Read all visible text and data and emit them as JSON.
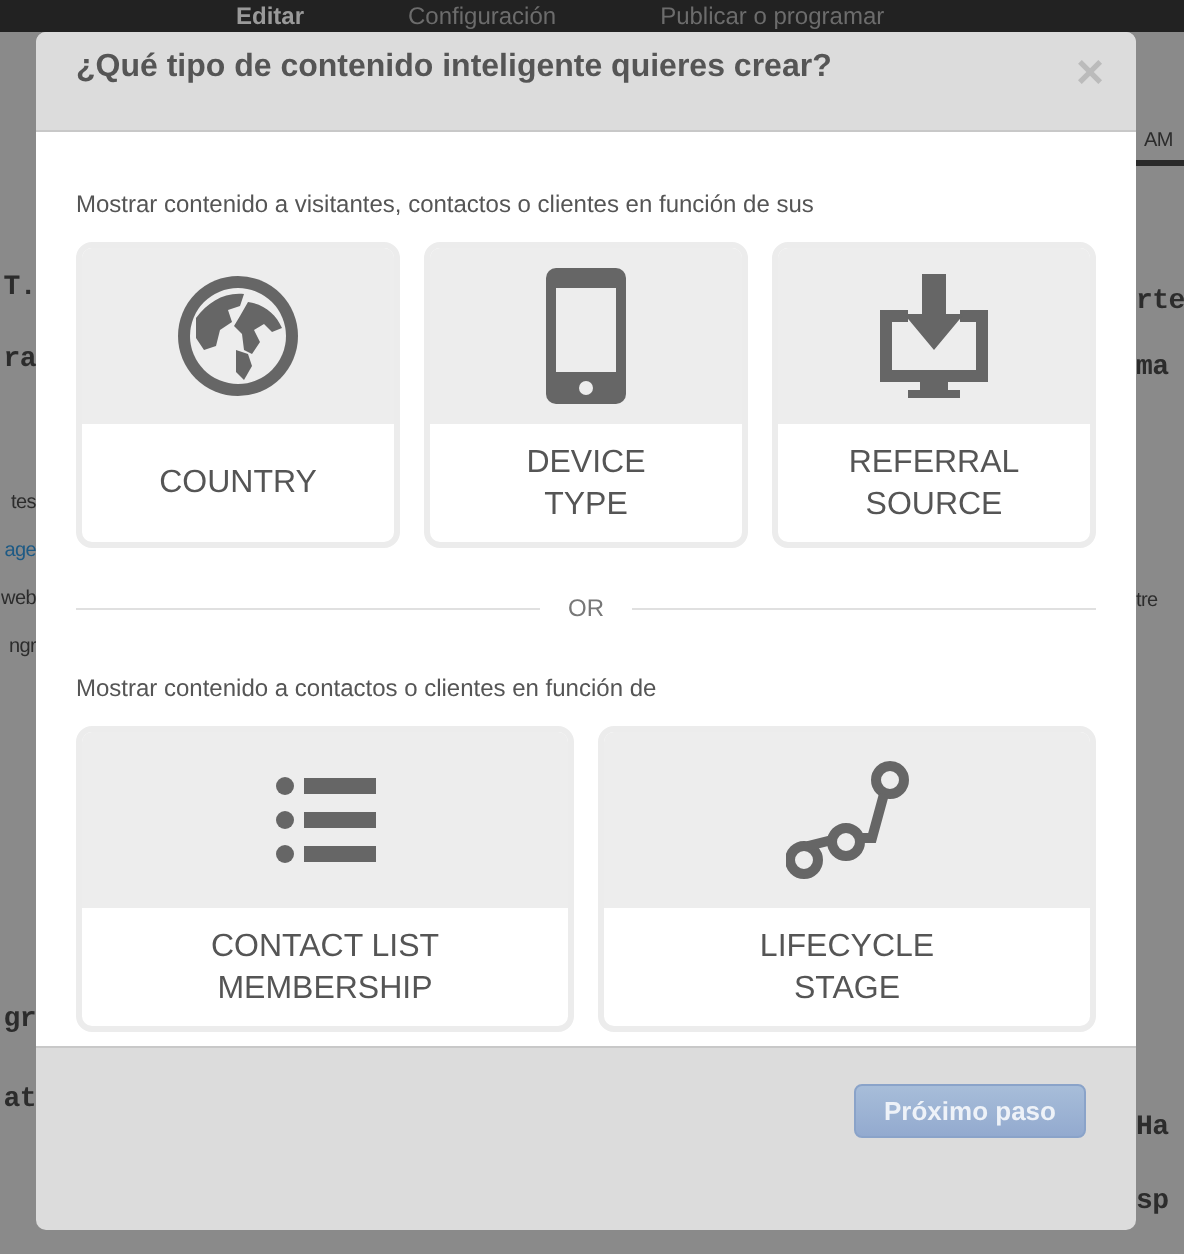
{
  "top_nav": [
    {
      "label": "Editar",
      "selected": true
    },
    {
      "label": "Configuración",
      "selected": false
    },
    {
      "label": "Publicar o programar",
      "selected": false
    }
  ],
  "background_left": [
    {
      "kind": "heading",
      "text": "T."
    },
    {
      "kind": "heading",
      "text": "ra"
    },
    {
      "kind": "text",
      "text": "tes"
    },
    {
      "kind": "link",
      "text": "age"
    },
    {
      "kind": "text",
      "text": "web"
    },
    {
      "kind": "text",
      "text": "ngr"
    },
    {
      "kind": "heading",
      "text": "gr"
    },
    {
      "kind": "heading",
      "text": "at"
    }
  ],
  "background_right": [
    {
      "kind": "tab",
      "text": "AM"
    },
    {
      "kind": "heading",
      "text": "rte"
    },
    {
      "kind": "heading",
      "text": "ma"
    },
    {
      "kind": "text",
      "text": "tre"
    },
    {
      "kind": "heading",
      "text": "Ha"
    },
    {
      "kind": "heading",
      "text": "sp"
    }
  ],
  "dialog": {
    "title": "¿Qué tipo de contenido inteligente quieres crear?",
    "close": "×",
    "sections": [
      {
        "subtitle": "Mostrar contenido a visitantes, contactos o clientes en función de sus",
        "options": [
          {
            "kind": "globe",
            "label": "COUNTRY"
          },
          {
            "kind": "phone",
            "label": "DEVICE\nTYPE"
          },
          {
            "kind": "download",
            "label": "REFERRAL\nSOURCE"
          }
        ]
      },
      {
        "subtitle": "Mostrar contenido a contactos o clientes en función de",
        "options": [
          {
            "kind": "list",
            "label": "CONTACT LIST\nMEMBERSHIP"
          },
          {
            "kind": "stages",
            "label": "LIFECYCLE\nSTAGE"
          }
        ]
      }
    ],
    "separator": "OR",
    "next_button": {
      "label": "Próximo paso",
      "disabled": true
    }
  }
}
